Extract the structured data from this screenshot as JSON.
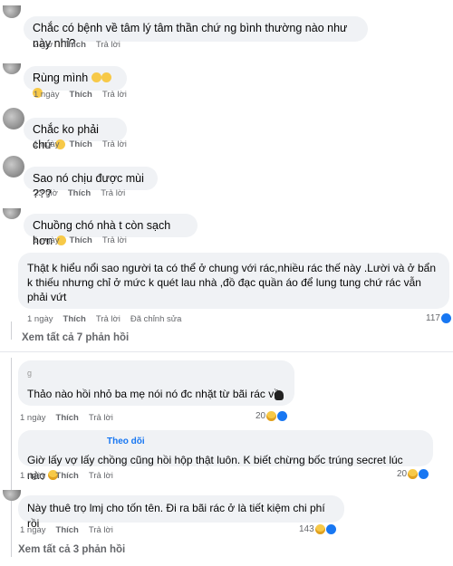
{
  "comments": [
    {
      "text": "Chắc có bệnh về tâm lý tâm thần chứ ng bình thường nào như này nhỉ?",
      "time": "2 giờ",
      "like": "Thích",
      "reply": "Trả lời"
    },
    {
      "text": "Rùng mình",
      "time": "1 ngày",
      "like": "Thích",
      "reply": "Trả lời"
    },
    {
      "text": "Chắc ko phải chứ",
      "time": "1 ngày",
      "like": "Thích",
      "reply": "Trả lời"
    },
    {
      "text": "Sao nó chịu được mùi ???",
      "time": "23 giờ",
      "like": "Thích",
      "reply": "Trả lời"
    },
    {
      "text": "Chuồng chó nhà t còn sạch hơn",
      "time": "1 ngày",
      "like": "Thích",
      "reply": "Trả lời"
    },
    {
      "text": "Thật k hiểu nổi sao người ta có thể ở chung với rác,nhiều rác thế này .Lười và ở bẩn k thiếu nhưng chỉ ở mức k quét lau nhà ,đồ đạc quần áo để lung tung chứ rác vẫn phải vứt",
      "time": "1 ngày",
      "like": "Thích",
      "reply": "Trả lời",
      "edited": "Đã chỉnh sửa",
      "reaction_count": "117"
    }
  ],
  "view_more_1": "Xem tất cả 7 phản hồi",
  "replies": [
    {
      "name": "g",
      "text": "Thảo nào hồi nhỏ ba mẹ nói nó đc nhặt từ bãi rác về",
      "time": "1 ngày",
      "like": "Thích",
      "reply": "Trả lời",
      "reaction_count": "20"
    },
    {
      "follow": "Theo dõi",
      "text": "Giờ lấy vợ lấy chồng cũng hồi hộp thật luôn. K biết chừng bốc trúng secret lúc nào",
      "time": "1 ngày",
      "like": "Thích",
      "reply": "Trả lời",
      "reaction_count": "20"
    },
    {
      "text": "Này thuê trọ lmj cho tốn tên. Đi ra bãi rác ở là tiết kiệm chi phí rồi",
      "time": "1 ngày",
      "like": "Thích",
      "reply": "Trả lời",
      "reaction_count": "143"
    }
  ],
  "view_more_2": "Xem tất cả 3 phản hồi"
}
